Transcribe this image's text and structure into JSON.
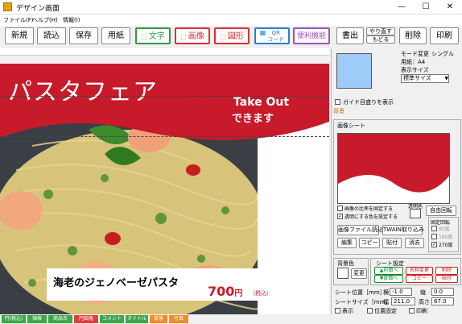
{
  "window": {
    "title": "デザイン画面",
    "minimize": "—",
    "maximize": "☐",
    "close": "✕"
  },
  "menu": [
    "ファイル(F)",
    "ヘルプ(H)",
    "情報(I)"
  ],
  "toolbar": {
    "new": "新規",
    "load": "読込",
    "save": "保存",
    "paper": "用紙",
    "text": "文字",
    "image": "画像",
    "shape": "図形",
    "qr": "QR\nコード",
    "convenience": "便利機能",
    "print_out": "書出",
    "redo": "やり直す",
    "undo": "もどる",
    "delete": "削除",
    "print": "印刷"
  },
  "poster": {
    "title": "パスタフェア",
    "takeout_1": "Take Out",
    "takeout_2": "できます",
    "dish": "海老のジェノベーゼパスタ",
    "price": "700",
    "price_unit": "円",
    "price_note": "（税込）"
  },
  "panel": {
    "mode_change": "モード変更",
    "single": "シングル",
    "paper_label": "用紙：A4",
    "display_size_label": "表示サイズ",
    "display_size_value": "標準サイズ",
    "guide_frame": "ガイド目盛りを表示",
    "background_header": "背景",
    "image_sheet": "画像シート",
    "keep_ratio": "画像の比率を固定する",
    "transparent_color_check": "透明にする色を設定する",
    "transparent_color": "透明色",
    "free_rotate": "自由回転",
    "image_file_load": "画像ファイル読込",
    "twain": "TWAIN取り込み",
    "edit": "編集",
    "copy": "コピー",
    "paste": "貼付",
    "erase": "消去",
    "fixed_rotate": "固定回転",
    "rot_90": "90度",
    "rot_180": "180度",
    "rot_270": "270度",
    "bg_color": "背景色",
    "change": "変更",
    "sheet_settings": "シート設定",
    "to_front": "▲前面へ",
    "to_back": "▼背面へ",
    "name_change": "名称変更",
    "copy2": "コピー",
    "delete": "削除",
    "paste2": "貼付",
    "sheet_pos": "シート位置［mm］",
    "horizontal": "横",
    "vertical": "縦",
    "pos_x": "-1.0",
    "pos_y": "0.0",
    "sheet_size": "シートサイズ［mm］",
    "width": "幅",
    "height": "高さ",
    "size_w": "211.0",
    "size_h": "67.0",
    "show": "表示",
    "pos_fixed": "位置固定",
    "print_check": "印刷"
  },
  "status_tabs": [
    "円(税込)",
    "価格",
    "商品名",
    "円図角",
    "コメント",
    "タイトル",
    "背景",
    "写真"
  ],
  "colors": {
    "brand_red": "#c71a2a",
    "swatch_blue": "#9ecbf7"
  }
}
